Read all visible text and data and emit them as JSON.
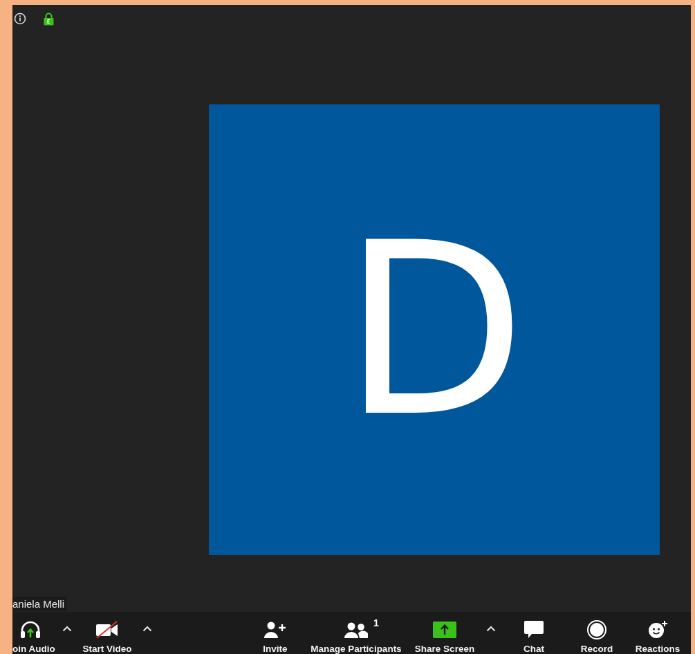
{
  "avatar_tile": {
    "initial": "D"
  },
  "name_label": "aniela Melli",
  "toolbar": [
    {
      "kind": "audio",
      "label": "oin Audio"
    },
    {
      "kind": "caret"
    },
    {
      "kind": "video",
      "label": "Start Video"
    },
    {
      "kind": "caret"
    },
    {
      "kind": "spacer"
    },
    {
      "kind": "invite",
      "label": "Invite"
    },
    {
      "kind": "participants",
      "label": "Manage Participants",
      "count": "1"
    },
    {
      "kind": "share",
      "label": "Share Screen"
    },
    {
      "kind": "caret"
    },
    {
      "kind": "chat",
      "label": "Chat"
    },
    {
      "kind": "record",
      "label": "Record"
    },
    {
      "kind": "reactions",
      "label": "Reactions"
    }
  ]
}
